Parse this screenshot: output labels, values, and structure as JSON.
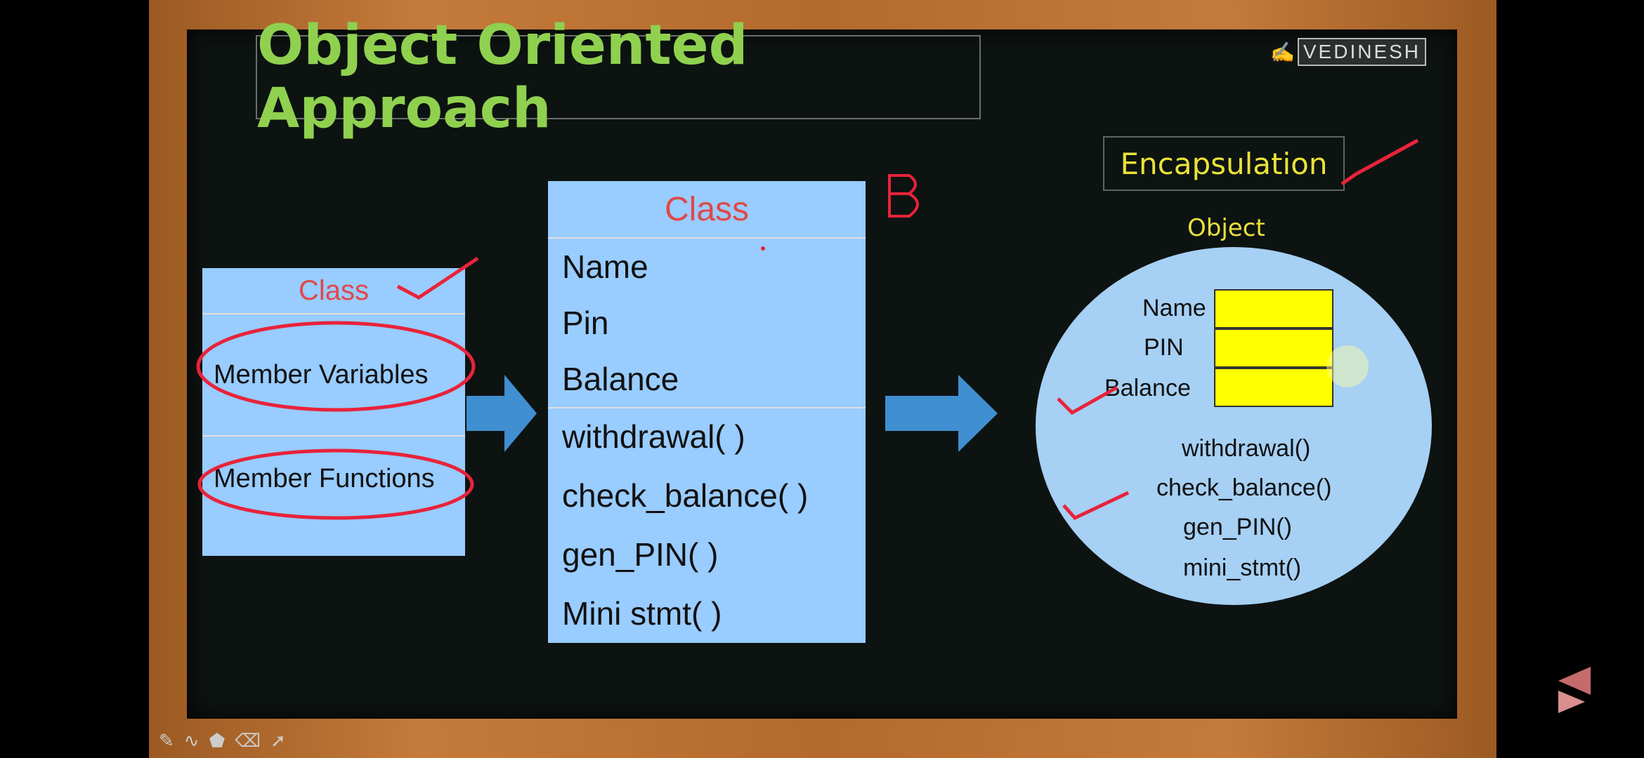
{
  "slide": {
    "title": "Object Oriented Approach",
    "logo_text": "VEDINESH",
    "encapsulation_label": "Encapsulation",
    "object_label": "Object",
    "annotation_letter": "B"
  },
  "small_class": {
    "header": "Class",
    "members": "Member Variables",
    "functions": "Member Functions"
  },
  "big_class": {
    "header": "Class",
    "variables": [
      "Name",
      "Pin",
      "Balance"
    ],
    "functions": [
      "withdrawal( )",
      "check_balance( )",
      "gen_PIN( )",
      "Mini stmt( )"
    ]
  },
  "object": {
    "fields": [
      "Name",
      "PIN",
      "Balance"
    ],
    "methods": [
      "withdrawal()",
      "check_balance()",
      "gen_PIN()",
      "mini_stmt()"
    ]
  },
  "colors": {
    "title_green": "#8fd14f",
    "class_blue": "#99ccff",
    "header_red": "#e04848",
    "encap_yellow": "#e9e23a",
    "field_yellow": "#ffff00",
    "ink_red": "#e8233a"
  },
  "icons": [
    "pen-icon",
    "wave-icon",
    "stamp-icon",
    "eraser-icon",
    "pointer-icon",
    "brand-logo-icon"
  ]
}
